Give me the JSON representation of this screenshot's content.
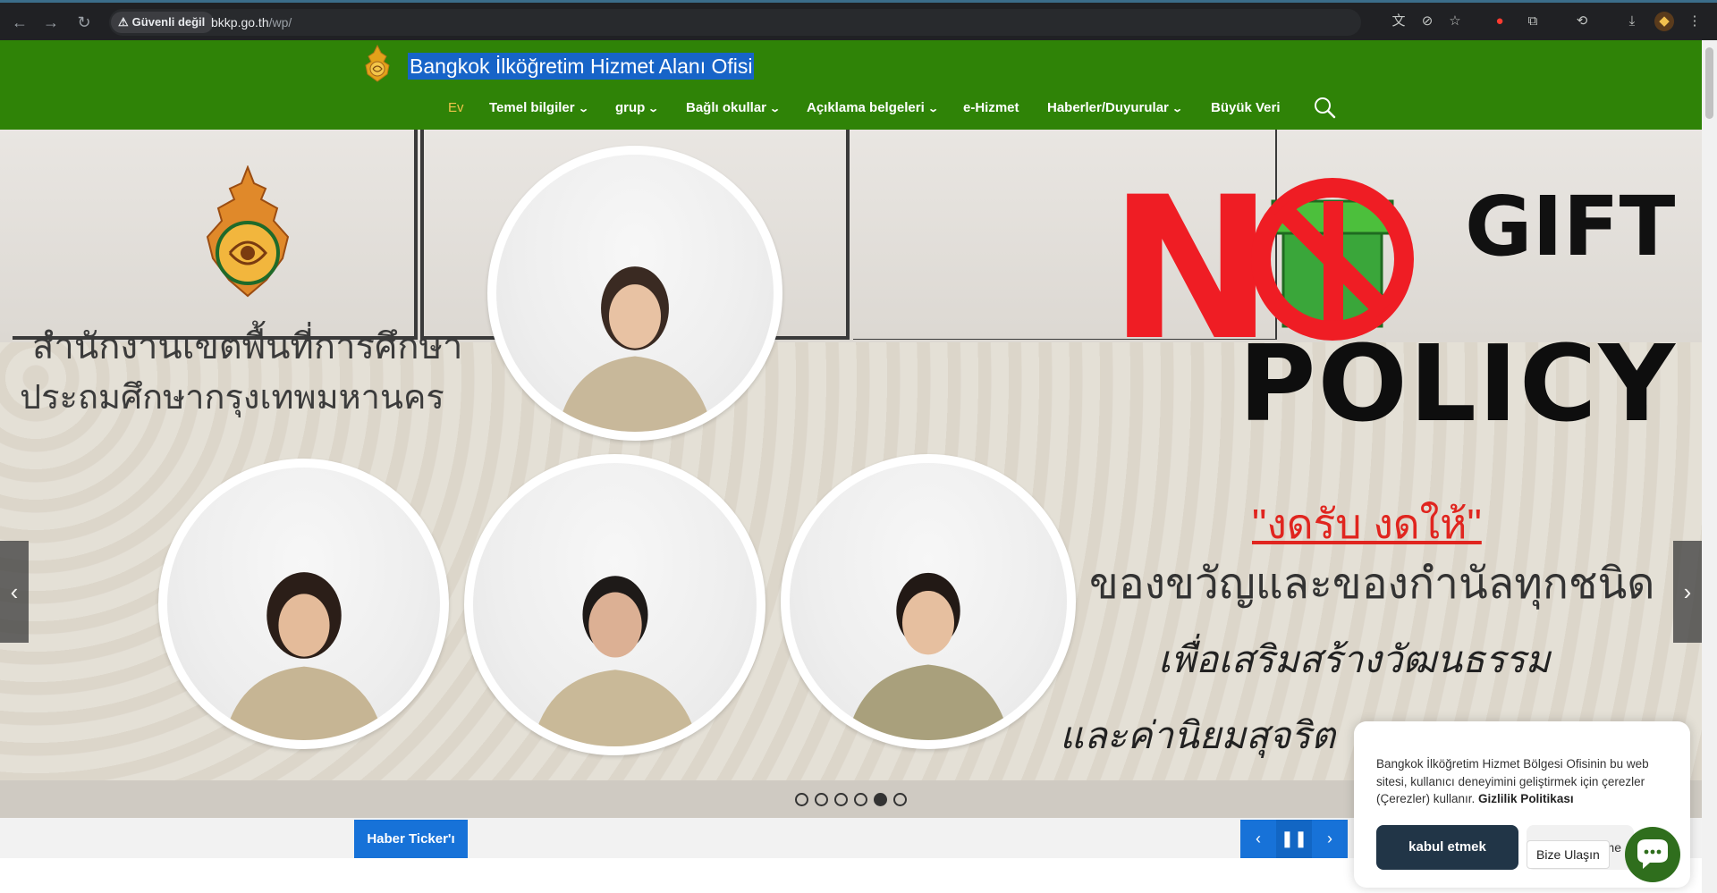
{
  "browser": {
    "security_label": "Güvenli değil",
    "url_host": "bkkp.go.th",
    "url_path": "/wp/"
  },
  "site": {
    "title": "Bangkok İlköğretim Hizmet Alanı Ofisi",
    "header_color": "#2f8307",
    "menu": [
      {
        "label": "Ev",
        "active": true
      },
      {
        "label": "Temel bilgiler",
        "dropdown": true
      },
      {
        "label": "grup",
        "dropdown": true
      },
      {
        "label": "Bağlı okullar",
        "dropdown": true
      },
      {
        "label": "Açıklama belgeleri",
        "dropdown": true
      },
      {
        "label": "e-Hizmet",
        "dropdown": false
      },
      {
        "label": "Haberler/Duyurular",
        "dropdown": true
      },
      {
        "label": "Büyük Veri",
        "dropdown": false
      }
    ]
  },
  "slider": {
    "office_line1": "สำนักงานเขตพื้นที่การศึกษา",
    "office_line2": "ประถมศึกษากรุงเทพมหานคร",
    "no_text": "N",
    "gift_text": "GIFT",
    "policy_text": "POLICY",
    "slogan_red": "\"งดรับ งดให้\"",
    "slogan_line2": "ของขวัญและของกำนัลทุกชนิด",
    "slogan_line3": "เพื่อเสริมสร้างวัฒนธรรม",
    "slogan_line4": "และค่านิยมสุจริต",
    "slide_count": 6,
    "active_slide": 5
  },
  "ticker": {
    "label": "Haber Ticker'ı"
  },
  "cookie": {
    "text": "Bangkok İlköğretim Hizmet Bölgesi Ofisinin bu web sitesi, kullanıcı deneyimini geliştirmek için çerezler (Çerezler) kullanır.",
    "policy_link": "Gizlilik Politikası",
    "accept_label": "kabul etmek",
    "other_label": "me"
  },
  "contact": {
    "label": "Bize Ulaşın"
  }
}
